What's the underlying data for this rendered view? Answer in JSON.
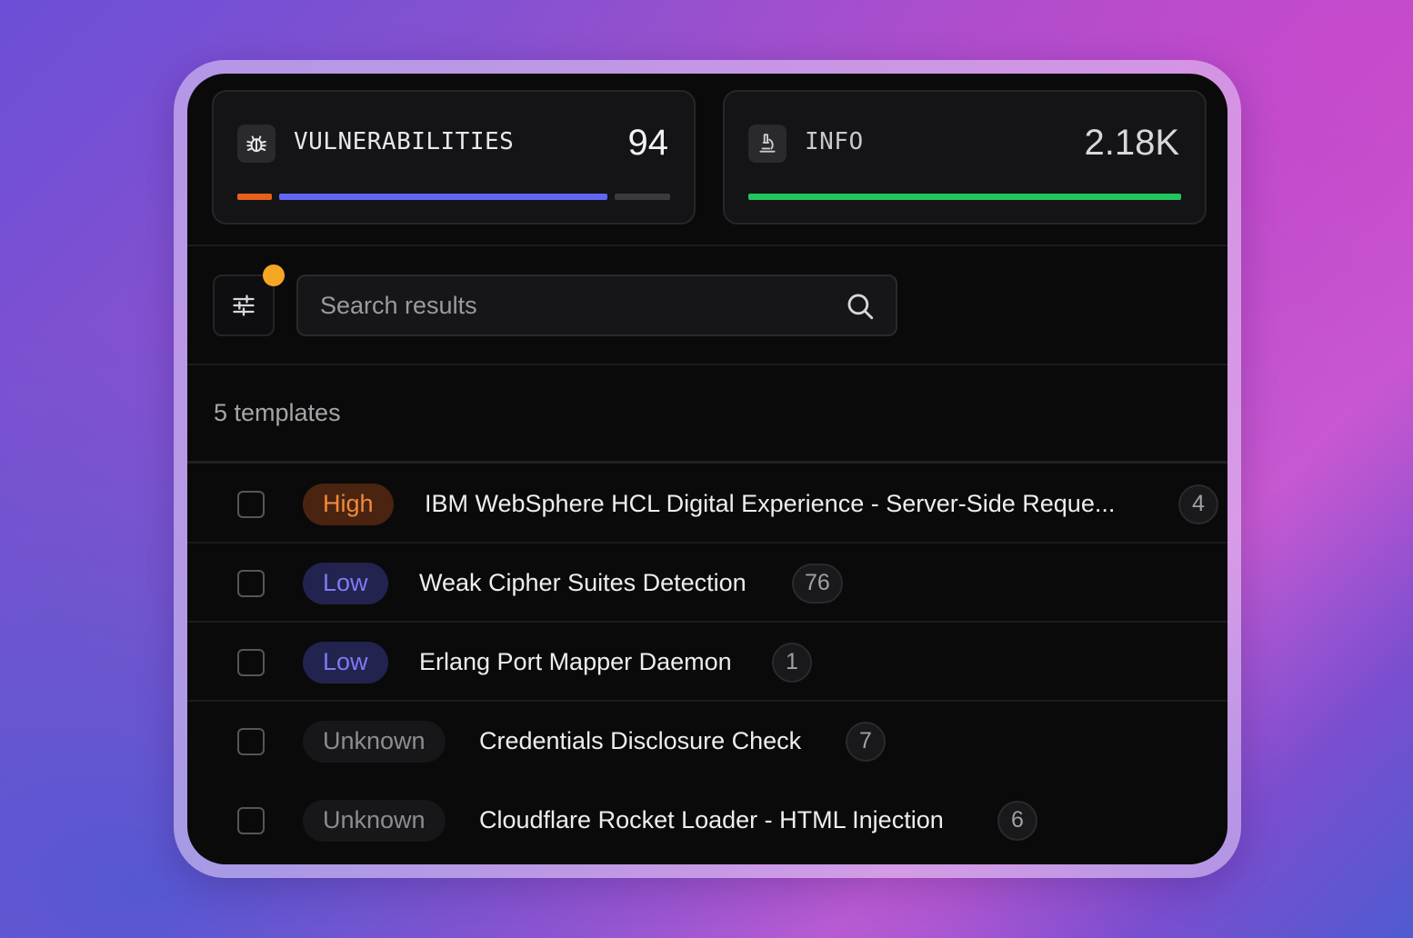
{
  "summary": {
    "vulnerabilities": {
      "label": "VULNERABILITIES",
      "value": "94",
      "icon": "bug-icon",
      "breakdown_colors": [
        "#e8601c",
        "#6366f1",
        "#3a3a3f"
      ]
    },
    "info": {
      "label": "INFO",
      "value": "2.18K",
      "icon": "microscope-icon",
      "bar_color": "#22c55e"
    }
  },
  "toolbar": {
    "filter_icon": "sliders-icon",
    "filter_indicator_color": "#f5a623",
    "search_placeholder": "Search results",
    "search_value": "",
    "search_icon": "search-icon"
  },
  "results": {
    "count_label": "5 templates",
    "rows": [
      {
        "severity": "High",
        "title": "IBM WebSphere HCL Digital Experience - Server-Side Reque...",
        "count": "4"
      },
      {
        "severity": "Low",
        "title": "Weak Cipher Suites Detection",
        "count": "76"
      },
      {
        "severity": "Low",
        "title": "Erlang Port Mapper Daemon",
        "count": "1"
      },
      {
        "severity": "Unknown",
        "title": "Credentials Disclosure Check",
        "count": "7"
      },
      {
        "severity": "Unknown",
        "title": "Cloudflare Rocket Loader - HTML Injection",
        "count": "6"
      }
    ]
  },
  "colors": {
    "severity_high": "#f08a3c",
    "severity_low": "#7b7cf2",
    "severity_unknown": "#8c8c92"
  }
}
